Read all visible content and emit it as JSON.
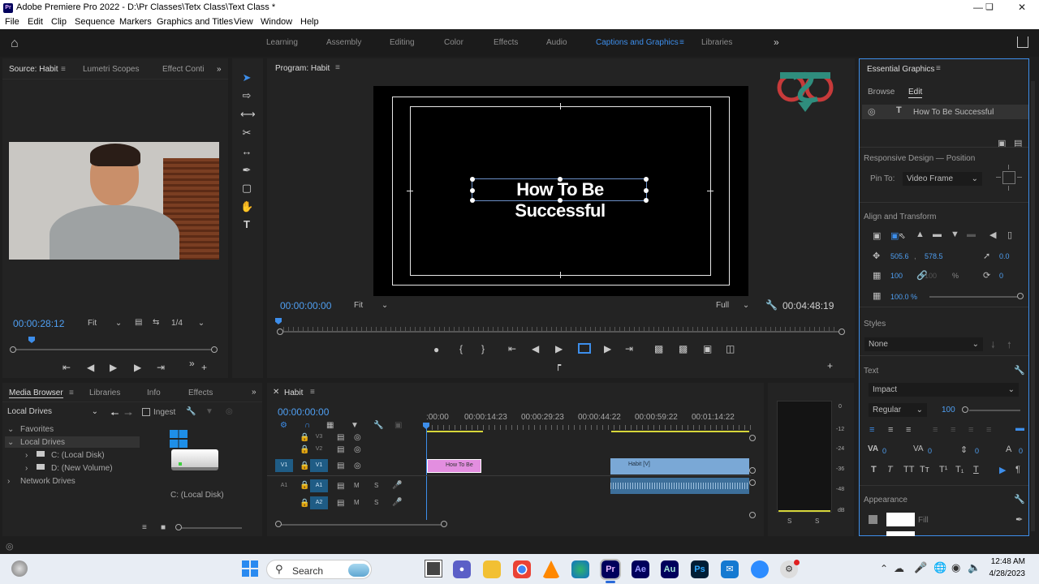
{
  "window": {
    "app_icon": "Pr",
    "title": "Adobe Premiere Pro 2022 - D:\\Pr Classes\\Tetx Class\\Text Class *"
  },
  "menu": [
    "File",
    "Edit",
    "Clip",
    "Sequence",
    "Markers",
    "Graphics and Titles",
    "View",
    "Window",
    "Help"
  ],
  "workspaces": [
    "Learning",
    "Assembly",
    "Editing",
    "Color",
    "Effects",
    "Audio",
    "Captions and Graphics",
    "Libraries"
  ],
  "active_workspace": "Captions and Graphics",
  "source_panel": {
    "tabs": [
      "Source: Habit",
      "Lumetri Scopes",
      "Effect Conti"
    ],
    "timecode": "00:00:28:12",
    "zoom": "Fit",
    "resolution": "1/4"
  },
  "program_panel": {
    "title": "Program: Habit",
    "overlay_text": "How To Be Successful",
    "timecode": "00:00:00:00",
    "zoom": "Fit",
    "quality": "Full",
    "duration": "00:04:48:19"
  },
  "media_browser": {
    "tabs": [
      "Media Browser",
      "Libraries",
      "Info",
      "Effects"
    ],
    "location": "Local Drives",
    "ingest_label": "Ingest",
    "tree": {
      "favorites": "Favorites",
      "local_drives": "Local Drives",
      "drive_c": "C: (Local Disk)",
      "drive_d": "D: (New Volume)",
      "network": "Network Drives"
    },
    "thumb_label": "C: (Local Disk)"
  },
  "timeline": {
    "title": "Habit",
    "timecode": "00:00:00:00",
    "ruler": [
      ":00:00",
      "00:00:14:23",
      "00:00:29:23",
      "00:00:44:22",
      "00:00:59:22",
      "00:01:14:22"
    ],
    "tracks": {
      "v3": "V3",
      "v2": "V2",
      "v1_src": "V1",
      "v1": "V1",
      "a1_src": "A1",
      "a1": "A1",
      "a2": "A2",
      "m": "M",
      "s": "S"
    },
    "clip_graphic": "How To Be",
    "clip_video": "Habit [V]"
  },
  "audio_meter": {
    "labels": [
      "0",
      "-12",
      "-24",
      "-36",
      "-48",
      "dB"
    ],
    "solo": [
      "S",
      "S"
    ]
  },
  "essential_graphics": {
    "title": "Essential Graphics",
    "tabs": [
      "Browse",
      "Edit"
    ],
    "layer_name": "How To Be Successful",
    "responsive_label": "Responsive Design — Position",
    "pin_to_label": "Pin To:",
    "pin_to_value": "Video Frame",
    "align_label": "Align and Transform",
    "pos_x": "505.6",
    "pos_y": "578.5",
    "rotation_anchor": "0.0",
    "scale": "100",
    "scale_locked": "100",
    "percent": "%",
    "rotation": "0",
    "opacity": "100.0 %",
    "styles_label": "Styles",
    "styles_value": "None",
    "text_label": "Text",
    "font": "Impact",
    "font_style": "Regular",
    "font_size": "100",
    "tracking": "0",
    "kerning": "0",
    "leading": "0",
    "baseline": "0",
    "appearance_label": "Appearance",
    "fill_label": "Fill"
  },
  "taskbar": {
    "search": "Search",
    "time": "12:48 AM",
    "date": "4/28/2023",
    "apps": [
      "Pr",
      "Ae",
      "Au",
      "Ps"
    ]
  },
  "colors": {
    "accent": "#3d8eeb",
    "track_blue": "#1f5c85",
    "graphic_clip": "#e38ee0",
    "video_clip": "#7aa8d6",
    "yellow_bar": "#d6d63a"
  }
}
